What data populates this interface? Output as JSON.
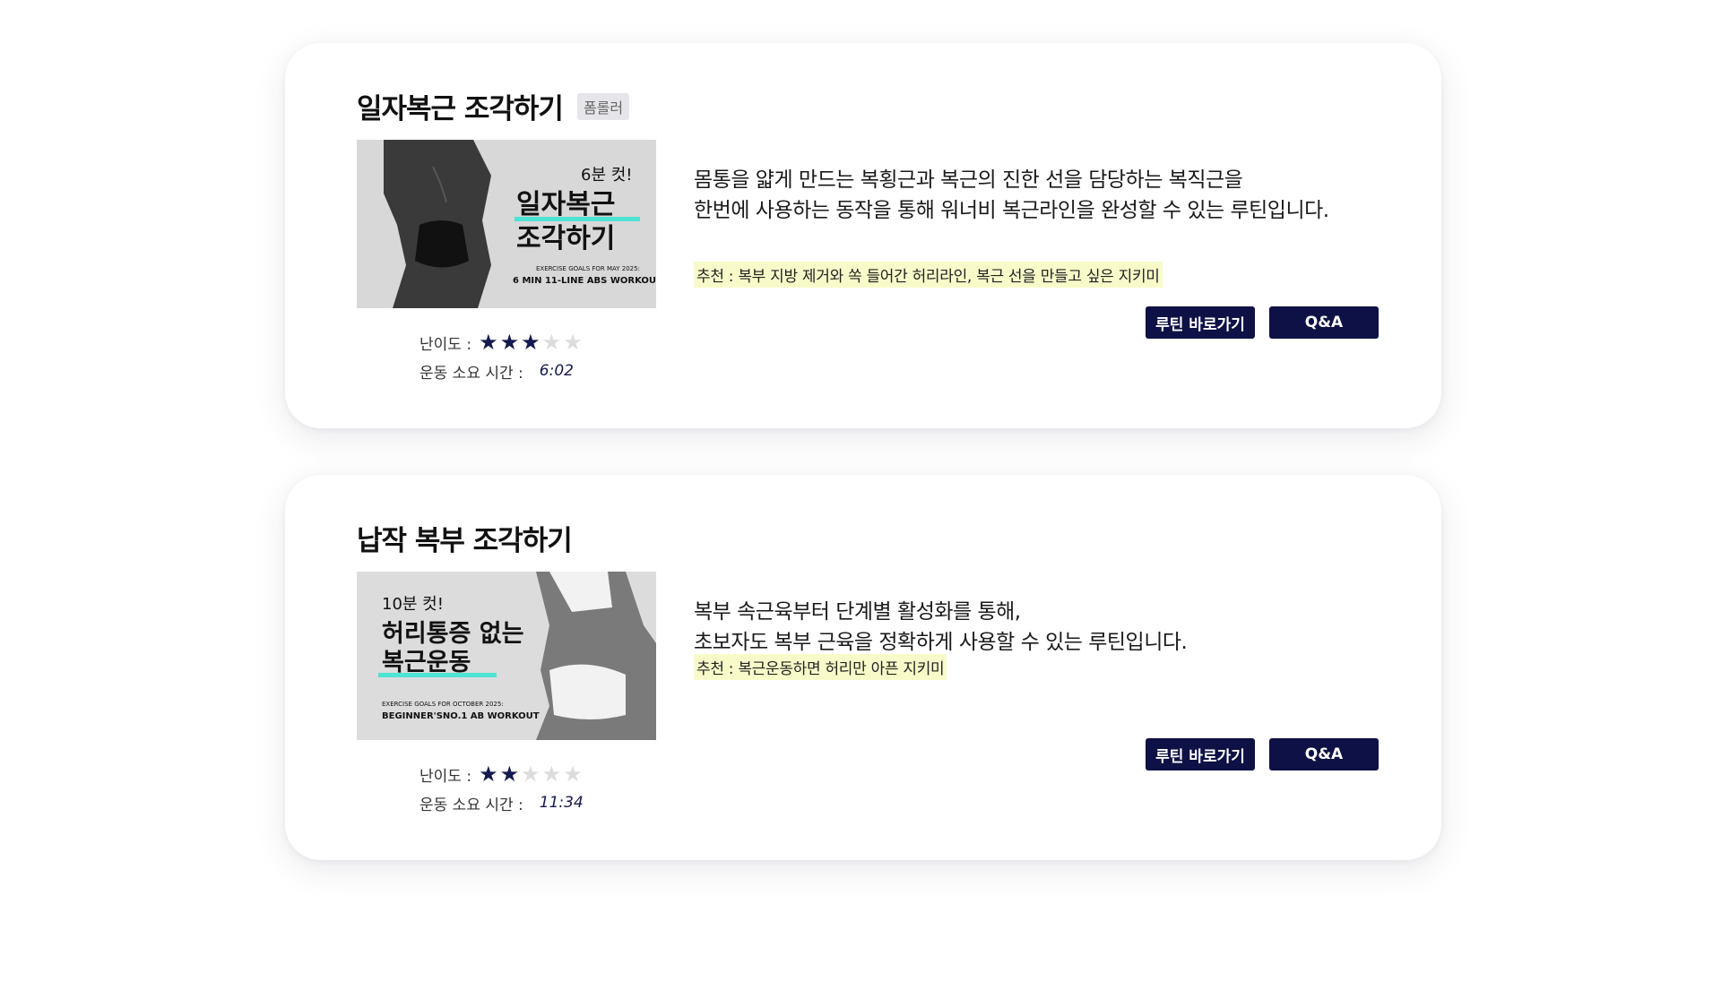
{
  "cards": [
    {
      "title": "일자복근 조각하기",
      "tag": "폼롤러",
      "thumbnail": {
        "small": "6분 컷!",
        "line1": "일자복근",
        "line2": "조각하기",
        "sub1": "EXERCISE GOALS FOR MAY 2025:",
        "sub2": "6 MIN 11-LINE ABS WORKOUT"
      },
      "desc_line1": "몸통을 얇게 만드는 복횡근과 복근의 진한 선을 담당하는 복직근을",
      "desc_line2": "한번에 사용하는 동작을 통해 워너비 복근라인을 완성할 수 있는 루틴입니다.",
      "recommend": "추천 : 복부 지방 제거와 쏙 들어간 허리라인, 복근 선을 만들고 싶은 지키미",
      "difficulty_label": "난이도 :",
      "difficulty": 3,
      "difficulty_max": 5,
      "time_label": "운동 소요 시간 :",
      "time": "6:02",
      "routine_btn": "루틴 바로가기",
      "qa_btn": "Q&A"
    },
    {
      "title": "납작 복부 조각하기",
      "tag": "",
      "thumbnail": {
        "small": "10분 컷!",
        "line1": "허리통증 없는",
        "line2": "복근운동",
        "sub1": "EXERCISE GOALS FOR OCTOBER 2025:",
        "sub2": "BEGINNER'SNO.1 AB WORKOUT"
      },
      "desc_line1": "복부 속근육부터 단계별 활성화를 통해,",
      "desc_line2": "초보자도 복부 근육을 정확하게 사용할 수 있는 루틴입니다.",
      "recommend": "추천 : 복근운동하면 허리만 아픈 지키미",
      "difficulty_label": "난이도 :",
      "difficulty": 2,
      "difficulty_max": 5,
      "time_label": "운동 소요 시간 :",
      "time": "11:34",
      "routine_btn": "루틴 바로가기",
      "qa_btn": "Q&A"
    }
  ],
  "colors": {
    "navy": "#0e1145",
    "star_filled": "#151a4d",
    "star_empty": "#dcdcdf",
    "highlight": "#f8fbc9",
    "tag_bg": "#e6e6ea"
  },
  "icons": {
    "star": "star-icon"
  }
}
